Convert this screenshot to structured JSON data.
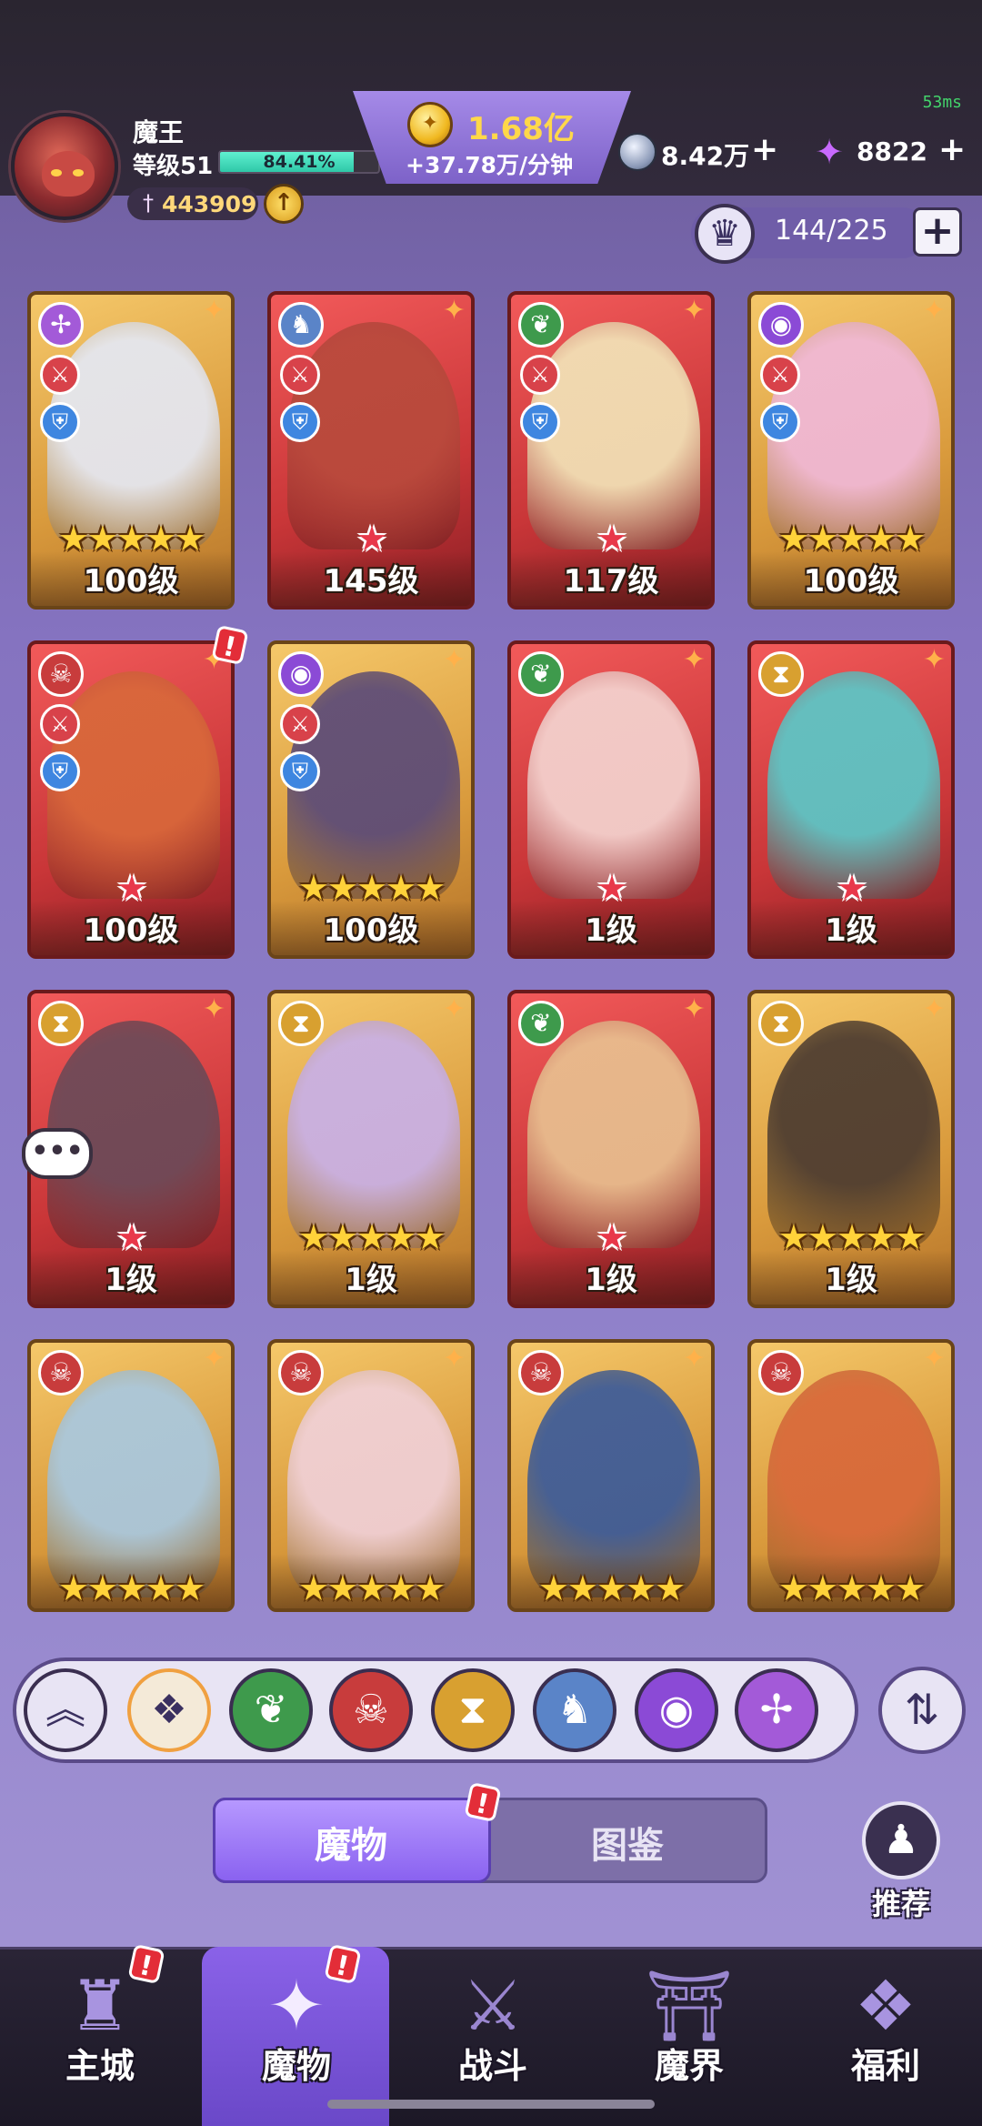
{
  "status": {
    "ping": "53ms"
  },
  "player": {
    "name": "魔王",
    "level": "等级51",
    "exp_percent_text": "84.41%",
    "exp_fraction": 0.8441,
    "power": "443909"
  },
  "currency": {
    "gold": "1.68亿",
    "gold_rate": "+37.78万/分钟",
    "silver": "8.42万",
    "gems": "8822",
    "plus": "+"
  },
  "capacity": {
    "text": "144/225",
    "plus": "+"
  },
  "cards": [
    {
      "level": "100级",
      "stars": "★★★★★",
      "star_style": "gold",
      "frame": "gold",
      "faction": "wind",
      "faction_icon": "✢",
      "faction_color": "#a35ad8",
      "art_color": "#e4e8f4",
      "badges": true
    },
    {
      "level": "145级",
      "stars": "★",
      "star_style": "red",
      "frame": "red",
      "faction": "dragon",
      "faction_icon": "♞",
      "faction_color": "#5a84c8",
      "art_color": "#b84a3c",
      "badges": true
    },
    {
      "level": "117级",
      "stars": "★",
      "star_style": "red",
      "frame": "red",
      "faction": "nature",
      "faction_icon": "❦",
      "faction_color": "#3e9a4c",
      "art_color": "#f2e4b8",
      "badges": true
    },
    {
      "level": "100级",
      "stars": "★★★★★",
      "star_style": "gold",
      "frame": "gold",
      "faction": "eye",
      "faction_icon": "◉",
      "faction_color": "#8b4ad6",
      "art_color": "#f0b8d8",
      "badges": true
    },
    {
      "level": "100级",
      "stars": "★",
      "star_style": "red",
      "frame": "red",
      "faction": "demon",
      "faction_icon": "☠",
      "faction_color": "#c83c3c",
      "art_color": "#d8683a",
      "badges": true,
      "alert": "!"
    },
    {
      "level": "100级",
      "stars": "★★★★★",
      "star_style": "gold",
      "frame": "gold",
      "faction": "eye",
      "faction_icon": "◉",
      "faction_color": "#8b4ad6",
      "art_color": "#5a4a78",
      "badges": true
    },
    {
      "level": "1级",
      "stars": "★",
      "star_style": "red",
      "frame": "red",
      "faction": "nature",
      "faction_icon": "❦",
      "faction_color": "#3e9a4c",
      "art_color": "#f4d4d0",
      "badges": false
    },
    {
      "level": "1级",
      "stars": "★",
      "star_style": "red",
      "frame": "red",
      "faction": "time",
      "faction_icon": "⧗",
      "faction_color": "#d8a030",
      "art_color": "#5ac8c8",
      "badges": false
    },
    {
      "level": "1级",
      "stars": "★",
      "star_style": "red",
      "frame": "red",
      "faction": "time",
      "faction_icon": "⧗",
      "faction_color": "#d8a030",
      "art_color": "#6a4a58",
      "badges": false
    },
    {
      "level": "1级",
      "stars": "★★★★★",
      "star_style": "gold",
      "frame": "gold",
      "faction": "time",
      "faction_icon": "⧗",
      "faction_color": "#d8a030",
      "art_color": "#c8b0e8",
      "badges": false
    },
    {
      "level": "1级",
      "stars": "★",
      "star_style": "red",
      "frame": "red",
      "faction": "nature",
      "faction_icon": "❦",
      "faction_color": "#3e9a4c",
      "art_color": "#e8c090",
      "badges": false
    },
    {
      "level": "1级",
      "stars": "★★★★★",
      "star_style": "gold",
      "frame": "gold",
      "faction": "time",
      "faction_icon": "⧗",
      "faction_color": "#d8a030",
      "art_color": "#4a3a30",
      "badges": false
    },
    {
      "level": "",
      "stars": "★★★★★",
      "star_style": "gold",
      "frame": "gold",
      "faction": "demon",
      "faction_icon": "☠",
      "faction_color": "#c83c3c",
      "art_color": "#a8c8e0",
      "badges": false
    },
    {
      "level": "",
      "stars": "★★★★★",
      "star_style": "gold",
      "frame": "gold",
      "faction": "demon",
      "faction_icon": "☠",
      "faction_color": "#c83c3c",
      "art_color": "#f0d0d8",
      "badges": false
    },
    {
      "level": "",
      "stars": "★★★★★",
      "star_style": "gold",
      "frame": "gold",
      "faction": "demon",
      "faction_icon": "☠",
      "faction_color": "#c83c3c",
      "art_color": "#3a5a9a",
      "badges": false
    },
    {
      "level": "",
      "stars": "★★★★★",
      "star_style": "gold",
      "frame": "gold",
      "faction": "demon",
      "faction_icon": "☠",
      "faction_color": "#c83c3c",
      "art_color": "#d8683a",
      "badges": false
    }
  ],
  "filters": [
    {
      "name": "collapse",
      "icon": "︽",
      "color": "#e8e4f4",
      "fg": "#3a3060"
    },
    {
      "name": "all",
      "icon": "❖",
      "color": "#f4ead8",
      "fg": "#3a3060"
    },
    {
      "name": "nature",
      "icon": "❦",
      "color": "#3e9a4c",
      "fg": "#ffffff"
    },
    {
      "name": "demon",
      "icon": "☠",
      "color": "#c83c3c",
      "fg": "#ffffff"
    },
    {
      "name": "time",
      "icon": "⧗",
      "color": "#d8a030",
      "fg": "#ffffff"
    },
    {
      "name": "dragon",
      "icon": "♞",
      "color": "#5a84c8",
      "fg": "#ffffff"
    },
    {
      "name": "eye",
      "icon": "◉",
      "color": "#8b4ad6",
      "fg": "#ffffff"
    },
    {
      "name": "wind",
      "icon": "✢",
      "color": "#a35ad8",
      "fg": "#ffffff"
    }
  ],
  "sort_icon": "⇅",
  "tabs": {
    "monsters": "魔物",
    "codex": "图鉴",
    "monsters_alert": "!"
  },
  "recommend": {
    "label": "推荐",
    "icon": "♟"
  },
  "nav": [
    {
      "label": "主城",
      "icon": "♜",
      "color": "#a894e0",
      "alert": "!"
    },
    {
      "label": "魔物",
      "icon": "✦",
      "color": "#f4ecff",
      "alert": "!"
    },
    {
      "label": "战斗",
      "icon": "⚔",
      "color": "#9a86d0",
      "alert": ""
    },
    {
      "label": "魔界",
      "icon": "⛩",
      "color": "#9a86d0",
      "alert": ""
    },
    {
      "label": "福利",
      "icon": "❖",
      "color": "#a894e0",
      "alert": ""
    }
  ]
}
